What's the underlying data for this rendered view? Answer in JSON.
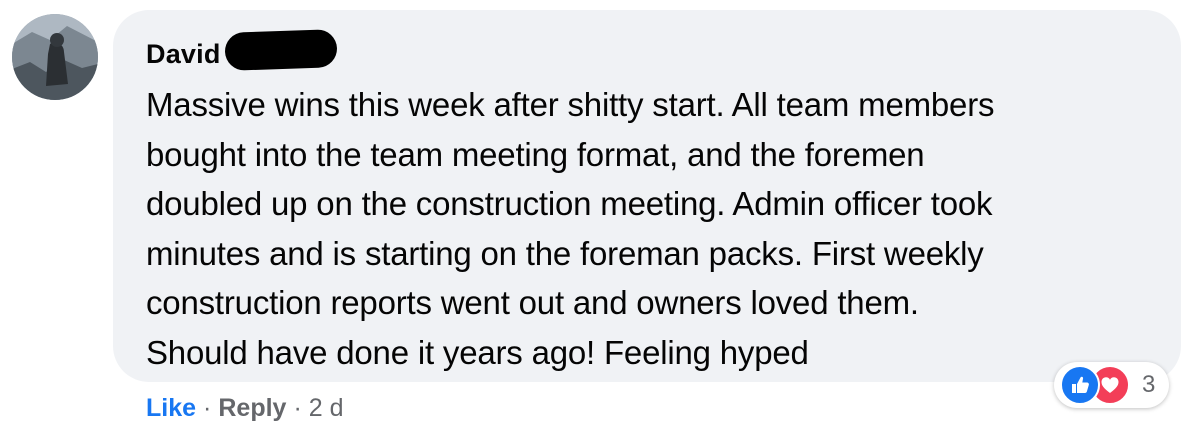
{
  "comment": {
    "author": "David",
    "text": "Massive wins this week after shitty start. All team members\nbought into the team meeting format, and the foremen\ndoubled up on the construction meeting. Admin officer took\nminutes and is starting on the foreman packs. First weekly\nconstruction reports went out and owners loved them.\nShould have done it years ago! Feeling hyped",
    "reactions": {
      "types": [
        "like-icon",
        "love-icon"
      ],
      "count": "3"
    },
    "actions": {
      "like": "Like",
      "separator": "·",
      "reply": "Reply",
      "time": "2 d"
    }
  },
  "colors": {
    "bubble": "#f0f2f5",
    "link_blue": "#1877f2",
    "love_red": "#f33e58",
    "secondary_text": "#65676b"
  }
}
